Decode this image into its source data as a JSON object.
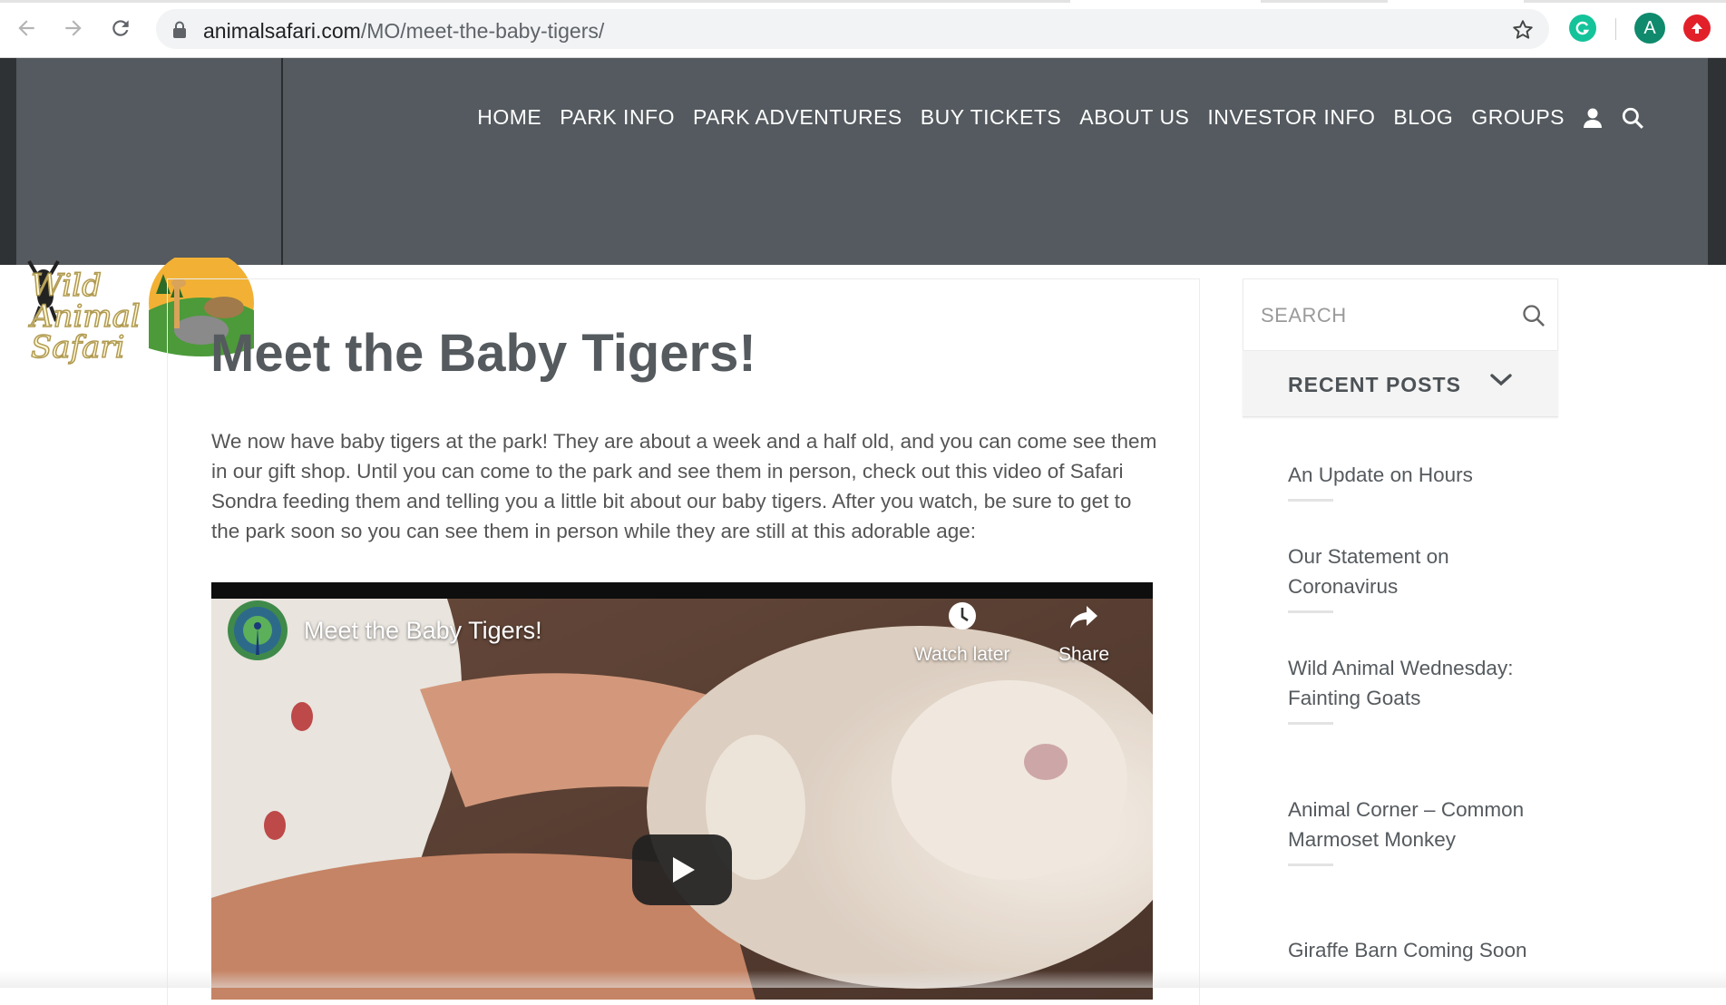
{
  "browser": {
    "url_host": "animalsafari.com",
    "url_path": "/MO/meet-the-baby-tigers/",
    "icons": [
      "back-arrow-icon",
      "forward-arrow-icon",
      "reload-icon",
      "lock-icon",
      "star-icon",
      "grammarly-icon",
      "profile-avatar-icon",
      "extension-icon"
    ],
    "profile_initial": "A"
  },
  "site": {
    "logo_text": "Wild Animal Safari",
    "nav": [
      "HOME",
      "PARK INFO",
      "PARK ADVENTURES",
      "BUY TICKETS",
      "ABOUT US",
      "INVESTOR INFO",
      "BLOG",
      "GROUPS"
    ],
    "nav_icons": [
      "user-icon",
      "search-icon"
    ],
    "colors": {
      "header_bg": "#545a5f",
      "header_edge": "#2f3234",
      "text": "#555a5e"
    }
  },
  "article": {
    "title": "Meet the Baby Tigers!",
    "body": "We now have baby tigers at the park! They are about a week and a half old, and you can come see them in our gift shop. Until you can come to the park and see them in person, check out this video of Safari Sondra feeding them and telling you a little bit about our baby tigers. After you watch, be sure to get to the park soon so you can see them in person while they are still at this adorable age:",
    "video": {
      "title": "Meet the Baby Tigers!",
      "watch_later": "Watch later",
      "share": "Share"
    }
  },
  "sidebar": {
    "search_placeholder": "SEARCH",
    "recent_posts_title": "RECENT POSTS",
    "recent_posts": [
      "An Update on Hours",
      "Our Statement on Coronavirus",
      "Wild Animal Wednesday: Fainting Goats",
      "Animal Corner – Common Marmoset Monkey",
      "Giraffe Barn Coming Soon"
    ]
  }
}
